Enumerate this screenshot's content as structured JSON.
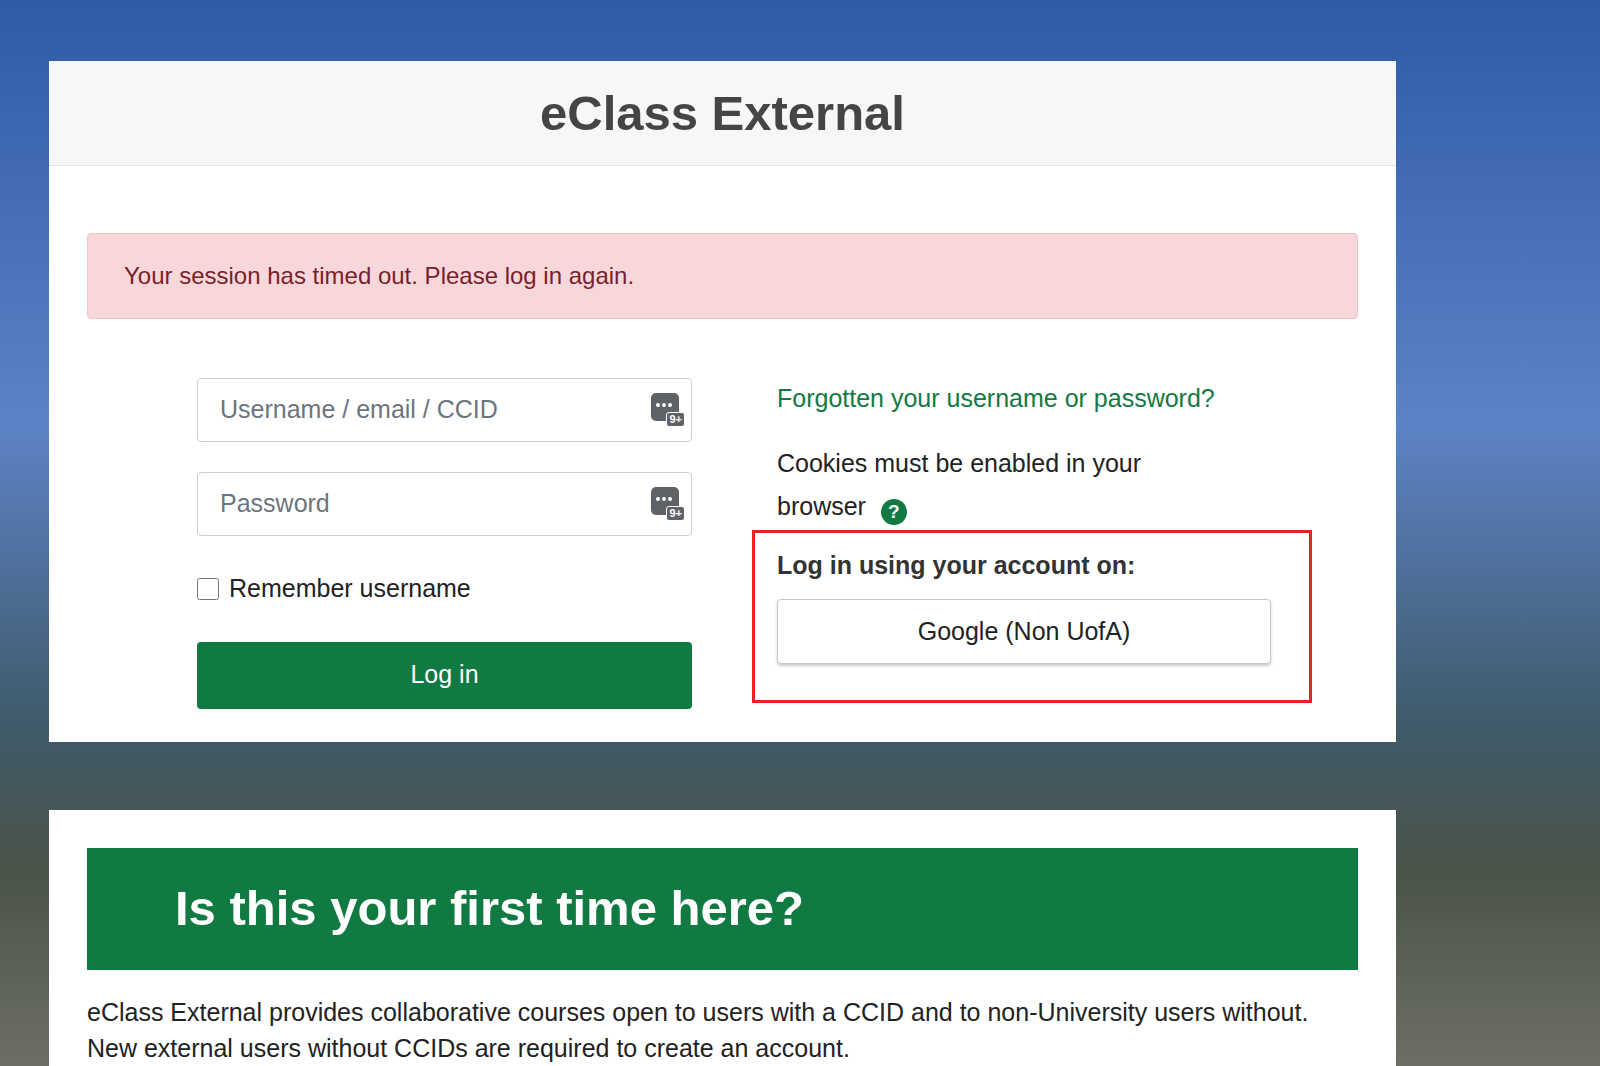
{
  "card": {
    "title": "eClass External"
  },
  "alert": {
    "text": "Your session has timed out. Please log in again."
  },
  "form": {
    "username": {
      "placeholder": "Username / email / CCID",
      "manager_badge": "9+"
    },
    "password": {
      "placeholder": "Password",
      "manager_badge": "9+"
    },
    "remember": {
      "label": "Remember username",
      "checked": false
    },
    "login_button": "Log in"
  },
  "side": {
    "forgot_link": "Forgotten your username or password?",
    "cookies_text": "Cookies must be enabled in your browser",
    "help_icon": "?",
    "providers_heading": "Log in using your account on:",
    "providers": [
      "Google (Non UofA)"
    ]
  },
  "welcome": {
    "heading": "Is this your first time here?",
    "paragraph": "eClass External provides collaborative courses open to users with a CCID and to non-University users without. New external users without CCIDs are required to create an account."
  }
}
